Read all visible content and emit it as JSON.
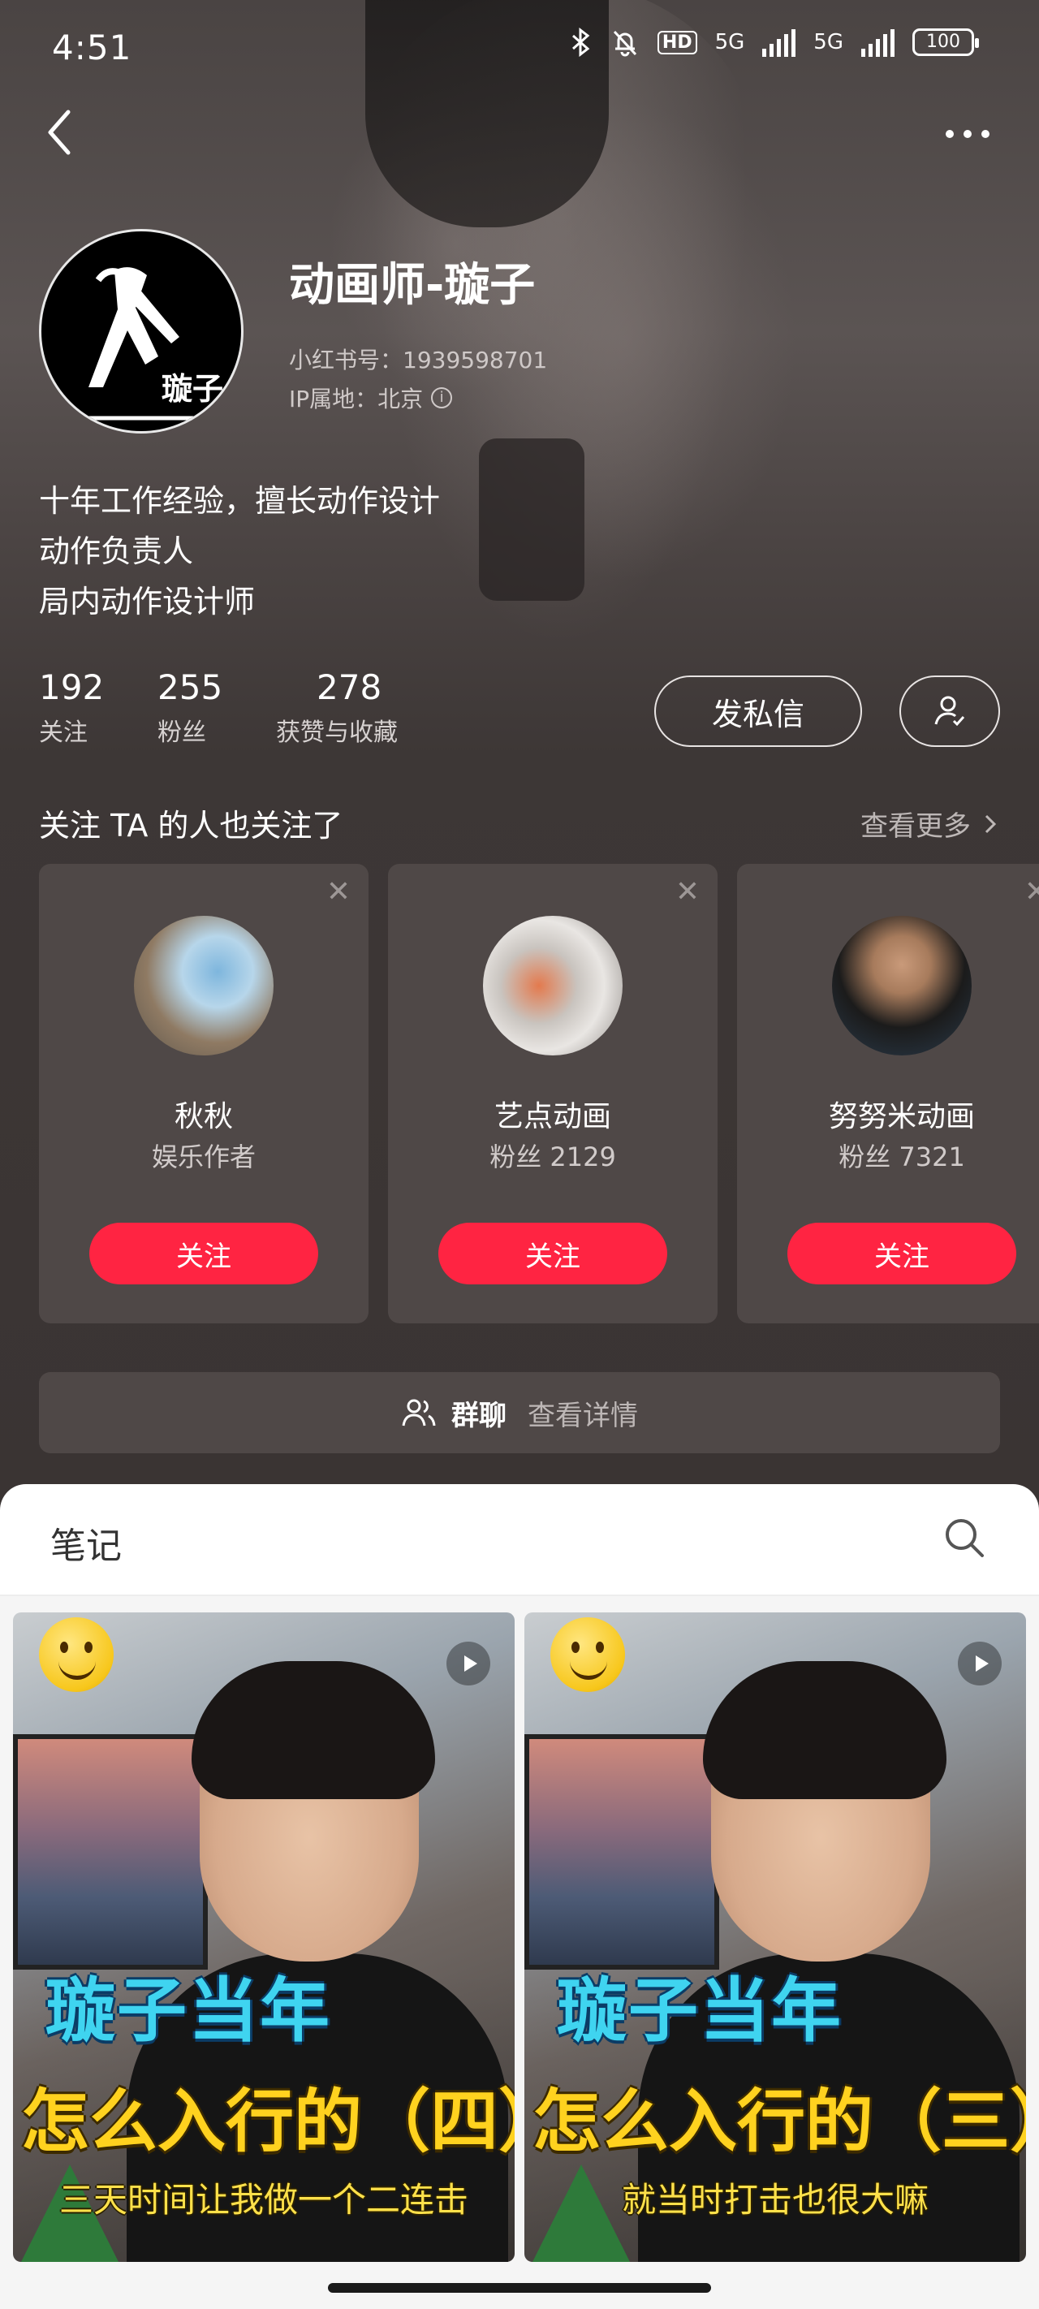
{
  "status_bar": {
    "time": "4:51",
    "net1": "5G",
    "net2": "5G",
    "hd": "HD",
    "battery": "100"
  },
  "profile": {
    "name": "动画师-璇子",
    "avatar_tag": "璇子",
    "id_line": "小红书号：1939598701",
    "ip_line": "IP属地：北京",
    "bio": [
      "十年工作经验，擅长动作设计",
      "动作负责人",
      "局内动作设计师"
    ],
    "stats": [
      {
        "value": "192",
        "label": "关注"
      },
      {
        "value": "255",
        "label": "粉丝"
      },
      {
        "value": "278",
        "label": "获赞与收藏"
      }
    ],
    "message_button": "发私信"
  },
  "recommendations": {
    "title": "关注 TA 的人也关注了",
    "more": "查看更多",
    "cards": [
      {
        "name": "秋秋",
        "sub": "娱乐作者",
        "button": "关注"
      },
      {
        "name": "艺点动画",
        "sub": "粉丝 2129",
        "button": "关注"
      },
      {
        "name": "努努米动画",
        "sub": "粉丝 7321",
        "button": "关注"
      }
    ]
  },
  "group_chat": {
    "label": "群聊",
    "detail": "查看详情"
  },
  "notes": {
    "tab": "笔记",
    "items": [
      {
        "title_line1": "璇子当年",
        "title_line2": "怎么入行的（四）",
        "caption": "三天时间让我做一个二连击"
      },
      {
        "title_line1": "璇子当年",
        "title_line2": "怎么入行的（三）",
        "caption": "就当时打击也很大嘛"
      }
    ]
  },
  "colors": {
    "accent": "#ff2442",
    "card_bg": "#4f4847"
  }
}
